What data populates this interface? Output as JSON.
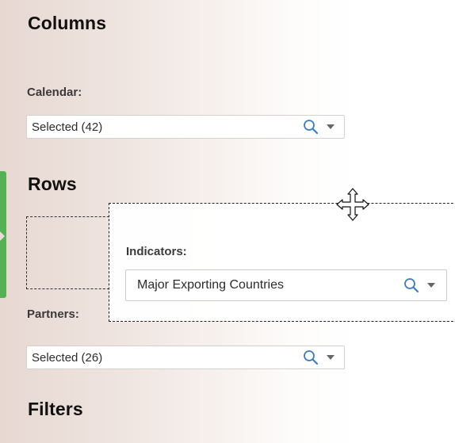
{
  "columns": {
    "title": "Columns",
    "calendar_label": "Calendar:",
    "calendar_value": "Selected (42)"
  },
  "rows": {
    "title": "Rows",
    "partners_label": "Partners:",
    "partners_value": "Selected (26)"
  },
  "dragging": {
    "label": "Indicators:",
    "value": "Major Exporting  Countries"
  },
  "filters": {
    "title": "Filters"
  },
  "icons": {
    "search": "search-icon",
    "dropdown": "chevron-down-icon",
    "move": "move-cursor-icon"
  },
  "colors": {
    "accent": "#56b055",
    "search_icon": "#3a7fc1"
  }
}
